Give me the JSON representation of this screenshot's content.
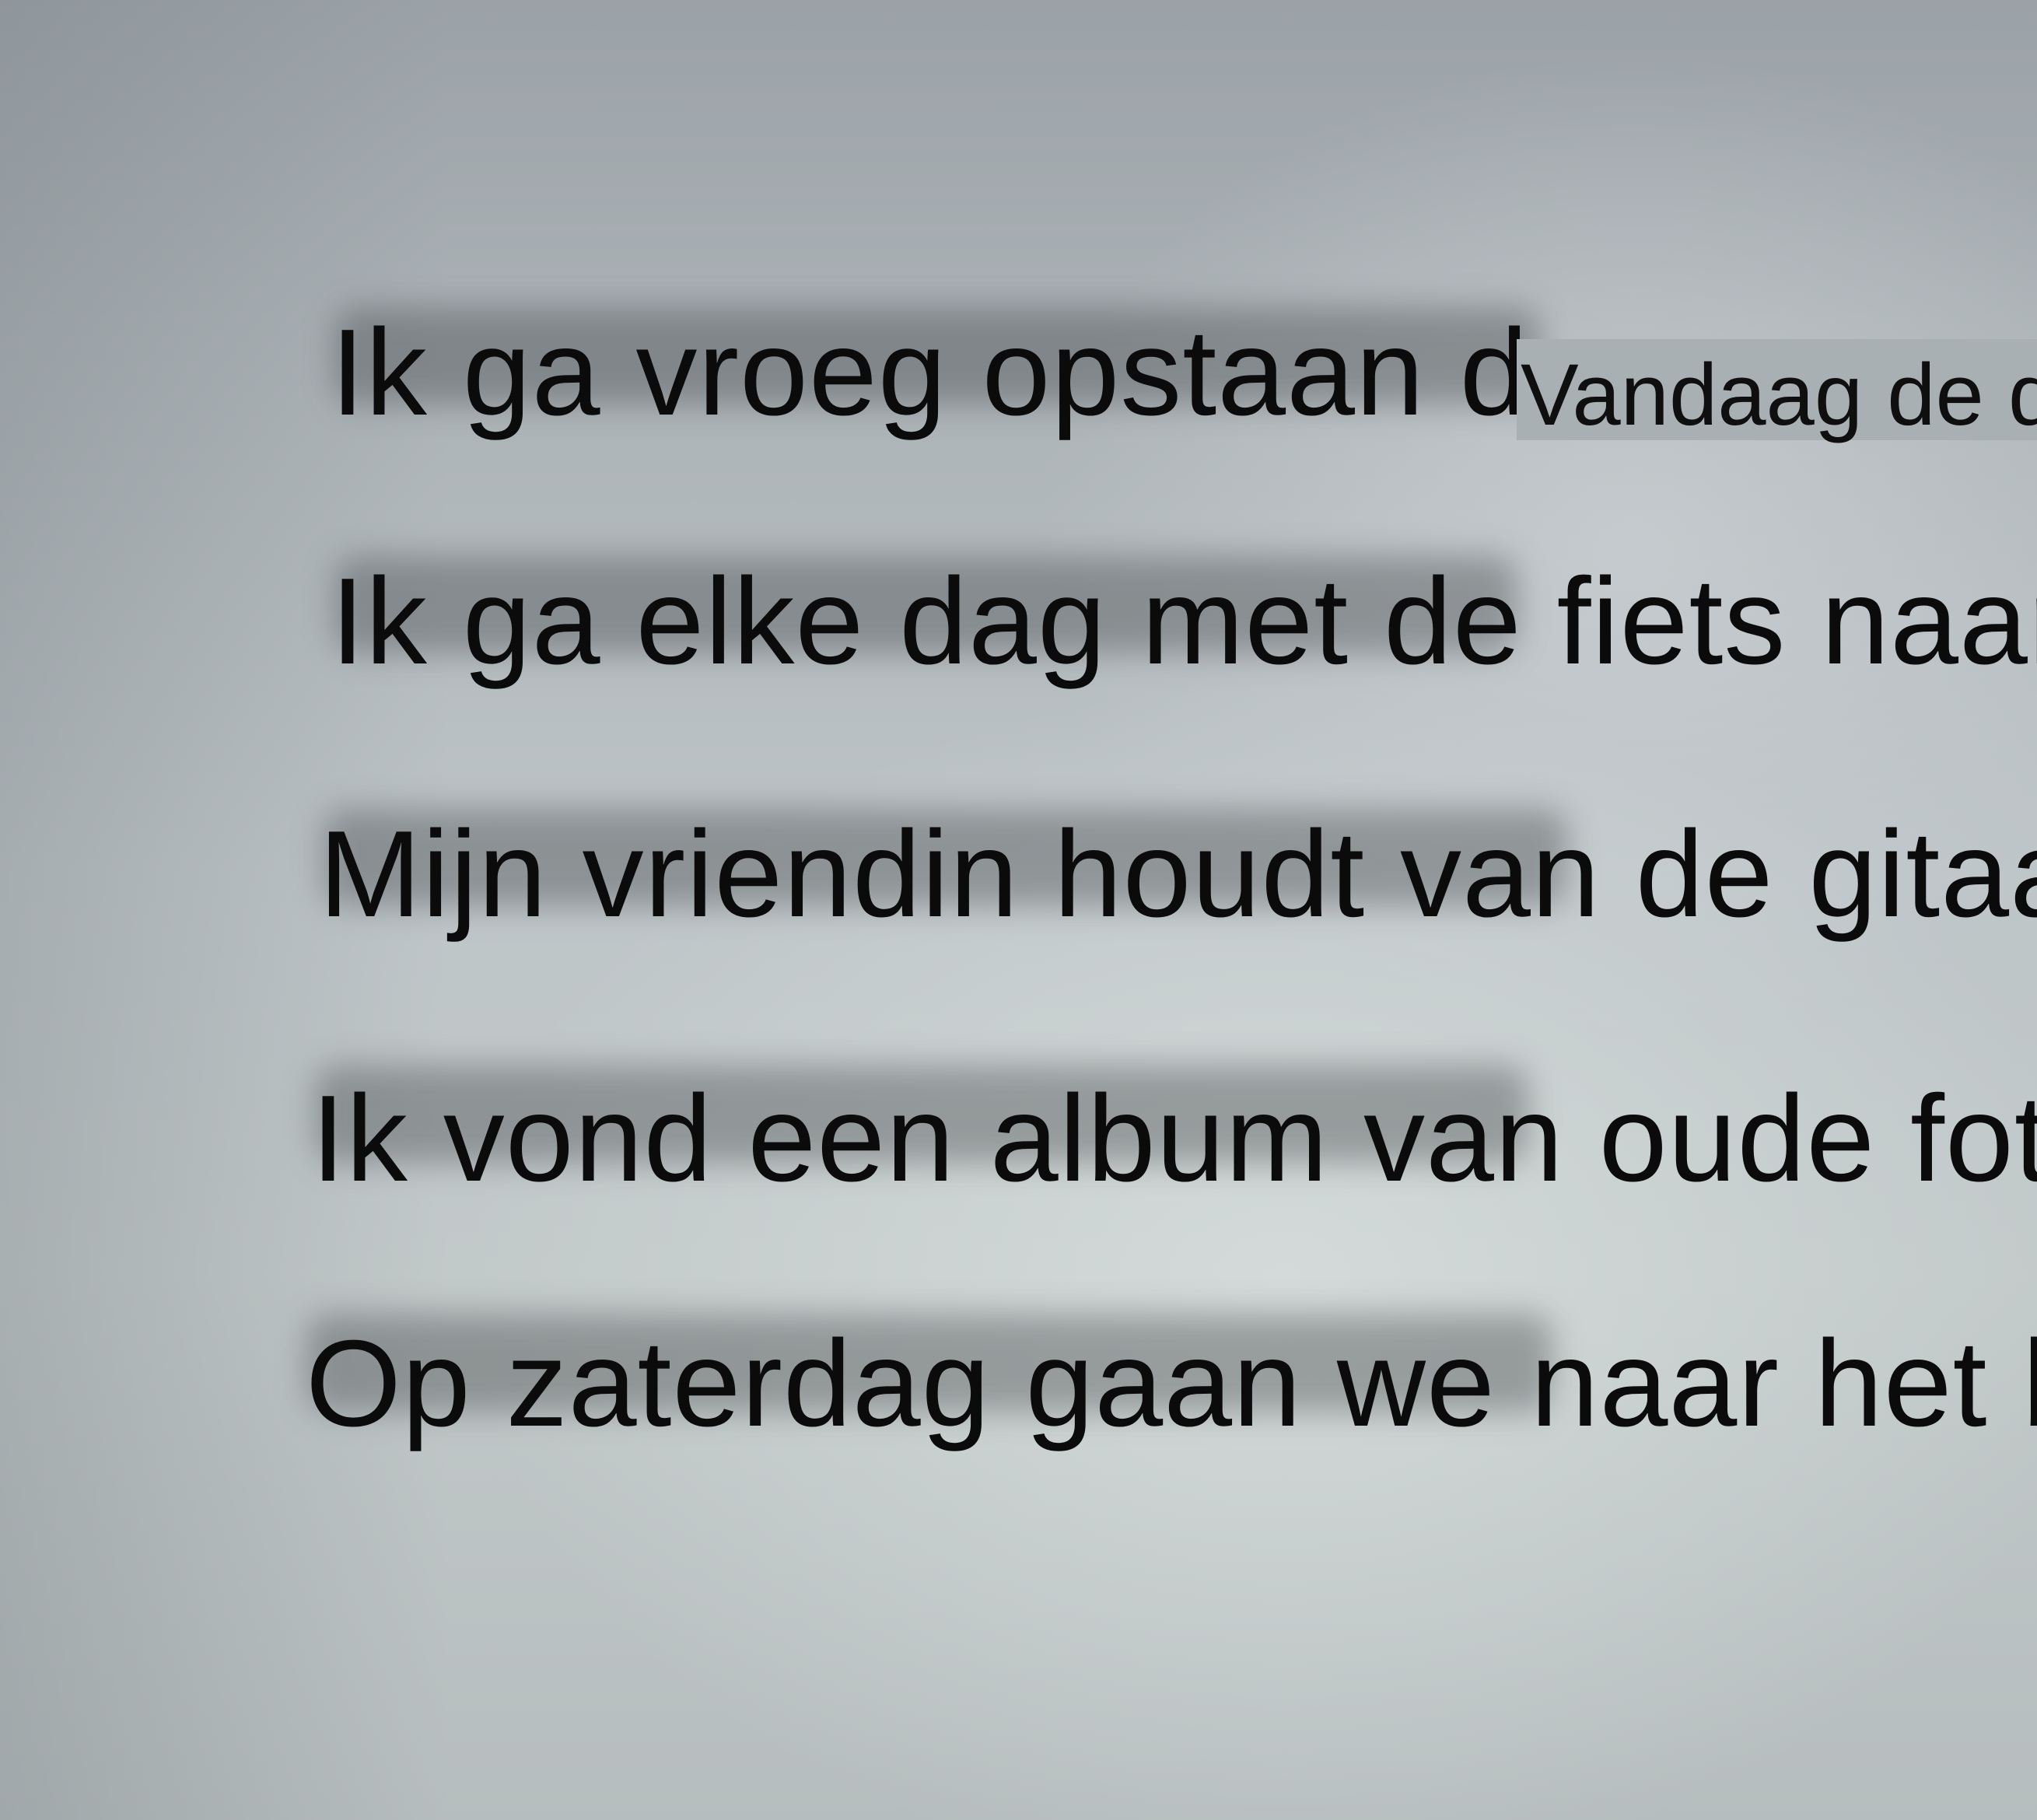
{
  "page": {
    "lines": [
      "Ik ga vroeg opstaan da",
      "Ik ga elke dag met de fiets naar he",
      "Mijn vriendin houdt van de gitaar.",
      "Ik vond een album van oude foto",
      "Op zaterdag gaan we naar het b"
    ],
    "line1_tail": "normaal",
    "overlay_fragment": "Vandaag de d"
  },
  "colors": {
    "paper": "#c0c7c9",
    "ink": "#0b0b0b"
  }
}
